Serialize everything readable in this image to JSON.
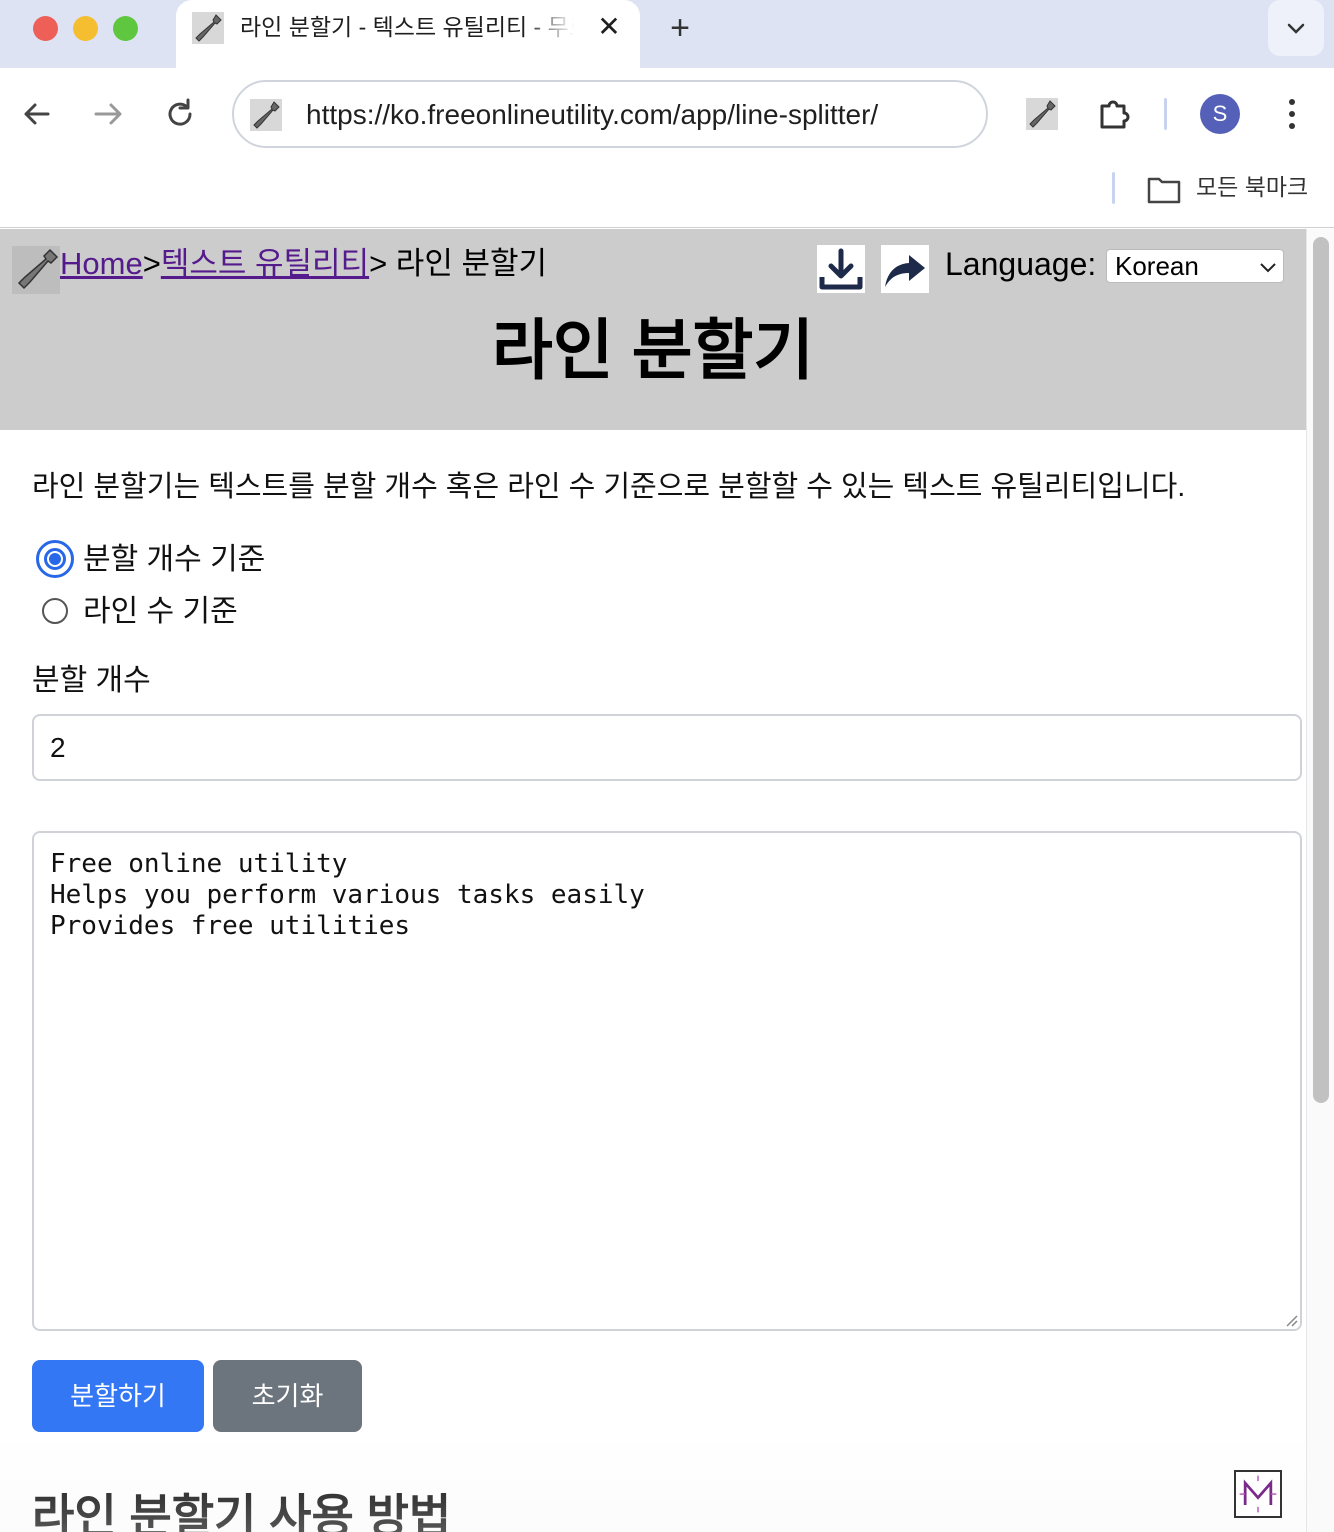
{
  "browser": {
    "tab_title": "라인 분할기 - 텍스트 유틸리티 - 무료 온라인 유틸리티",
    "tab_close": "✕",
    "new_tab": "+",
    "url": "https://ko.freeonlineutility.com/app/line-splitter/",
    "avatar_initial": "S",
    "bookmarks_label": "모든 북마크"
  },
  "header": {
    "breadcrumb": {
      "home": "Home",
      "sep1": ">",
      "category": "텍스트 유틸리티",
      "sep2": "> ",
      "current": "라인 분할기"
    },
    "language_label": "Language:",
    "language_selected": "Korean",
    "title": "라인 분할기"
  },
  "main": {
    "intro": "라인 분할기는 텍스트를 분할 개수 혹은 라인 수 기준으로 분할할 수 있는 텍스트 유틸리티입니다.",
    "split_options": [
      {
        "label": "분할 개수 기준",
        "checked": true
      },
      {
        "label": "라인 수 기준",
        "checked": false
      }
    ],
    "count_label": "분할 개수",
    "count_value": "2",
    "text_value": "Free online utility\nHelps you perform various tasks easily\nProvides free utilities",
    "split_button": "분할하기",
    "reset_button": "초기화",
    "how_to_title": "라인 분할기 사용 방법"
  },
  "colors": {
    "primary_button": "#3477f5",
    "secondary_button": "#6c757d",
    "header_bg": "#cccccc",
    "radio_accent": "#2868e8",
    "link_visited": "#551a8b"
  },
  "icons": [
    "wrench-icon",
    "back-arrow-icon",
    "forward-arrow-icon",
    "reload-icon",
    "extensions-icon",
    "kebab-menu-icon",
    "folder-icon",
    "download-icon",
    "share-icon",
    "chevron-down-icon"
  ]
}
